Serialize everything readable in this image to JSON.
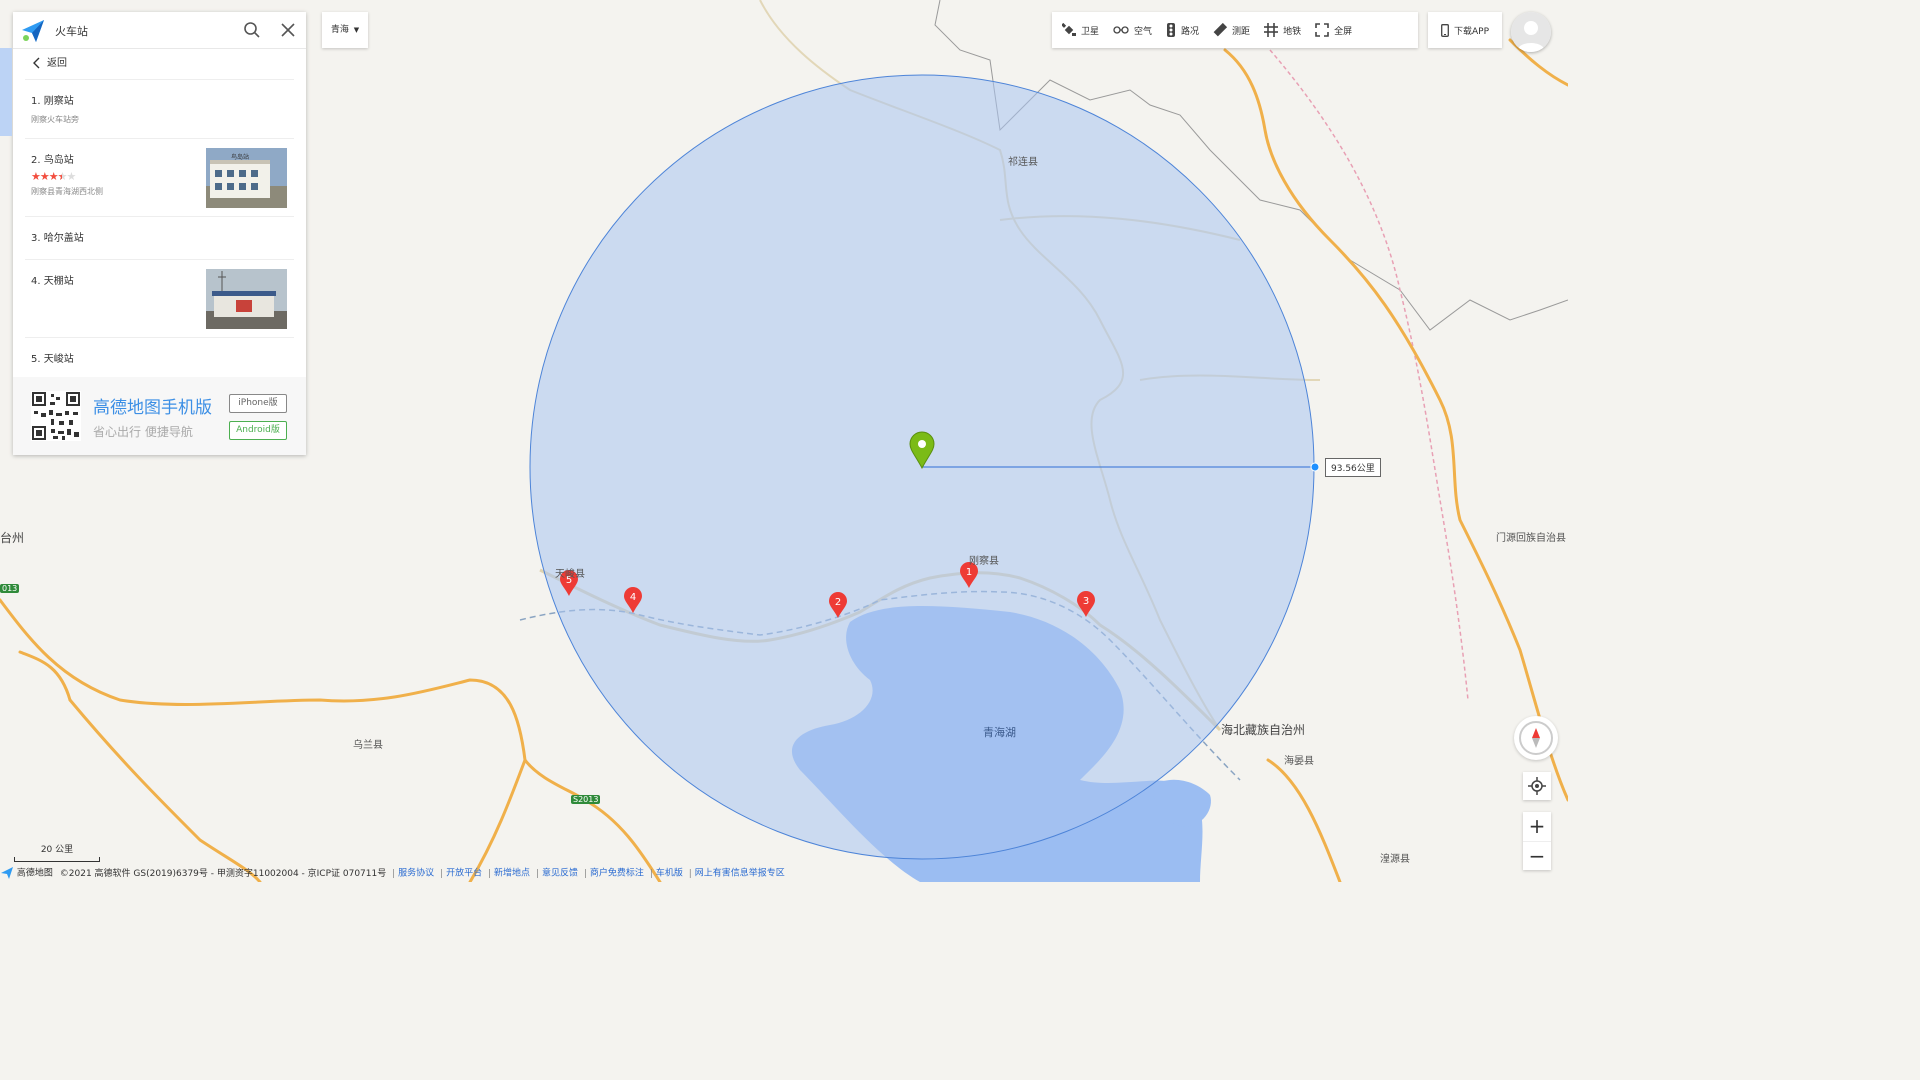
{
  "search": {
    "query": "火车站",
    "city": "青海"
  },
  "back_label": "返回",
  "results": [
    {
      "title": "1. 刚察站",
      "subtitle": "刚察火车站旁",
      "rating": null,
      "has_image": false
    },
    {
      "title": "2. 鸟岛站",
      "subtitle": "刚察县青海湖西北侧",
      "rating": 3.5,
      "has_image": true,
      "image_caption": "鸟岛站"
    },
    {
      "title": "3. 哈尔盖站",
      "subtitle": "",
      "rating": null,
      "has_image": false
    },
    {
      "title": "4. 天棚站",
      "subtitle": "",
      "rating": null,
      "has_image": true
    },
    {
      "title": "5. 天峻站",
      "subtitle": "",
      "rating": null,
      "has_image": false
    }
  ],
  "promo": {
    "title": "高德地图手机版",
    "subtitle": "省心出行 便捷导航",
    "ios_label": "iPhone版",
    "android_label": "Android版"
  },
  "toolbar": {
    "satellite": "卫星",
    "weather": "空气",
    "traffic": "路况",
    "ruler": "测距",
    "subway": "地铁",
    "fullscreen": "全屏"
  },
  "download_app": "下载APP",
  "measure_label": "93.56公里",
  "map_labels": {
    "qilian": "祁连县",
    "gangcha": "刚察县",
    "tianjun": "天峻县",
    "qinghaihu": "青海湖",
    "haibei": "海北藏族自治州",
    "haiyan": "海晏县",
    "wulan": "乌兰县",
    "menyuan": "门源回族自治县",
    "huangyuan": "湟源县",
    "taizhou": "台州",
    "s2013": "S2013",
    "s2013b": "013"
  },
  "markers": [
    "1",
    "2",
    "3",
    "4",
    "5"
  ],
  "scale": "20 公里",
  "footer": {
    "brand": "高德地图",
    "copyright": "©2021 高德软件 GS(2019)6379号 - 甲测资字11002004 - 京ICP证 070711号",
    "links": [
      "服务协议",
      "开放平台",
      "新增地点",
      "意见反馈",
      "商户免费标注",
      "车机版",
      "网上有害信息举报专区"
    ]
  },
  "colors": {
    "circle_fill": "#a9c5f0",
    "circle_stroke": "#4d84d8",
    "lake": "#9bbdf2",
    "marker": "#ee3b35",
    "pin": "#7bbb16",
    "road": "#f0b04a",
    "accent": "#3c8fe5"
  }
}
